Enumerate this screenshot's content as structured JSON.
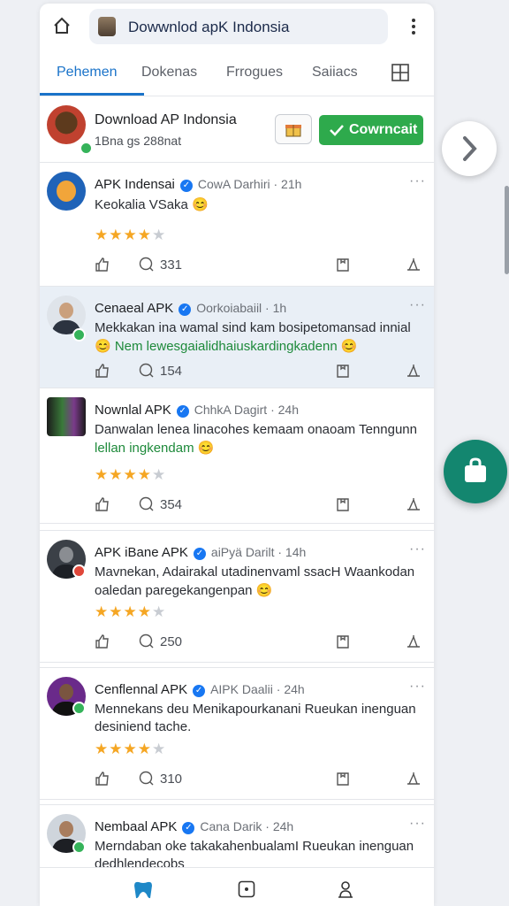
{
  "urlbar": {
    "text": "Dowwnlod apK Indonsia"
  },
  "tabs": [
    {
      "label": "Pehemen"
    },
    {
      "label": "Dokenas"
    },
    {
      "label": "Frrogues"
    },
    {
      "label": "Saiiacs"
    }
  ],
  "header": {
    "title": "Download AP Indonsia",
    "subtitle": "1Bna gs 288nat",
    "download_label": "Cowrncait"
  },
  "posts": [
    {
      "name": "APK Indensai",
      "meta": "CowA Darhiri · 21h",
      "line1": "Keokalia VSaka 😊",
      "line2": "",
      "stars": 4,
      "count": "331",
      "highlight": false
    },
    {
      "name": "Cenaeal APK",
      "meta": "Oorkoiabaiil · 1h",
      "line1": "Mekkakan ina wamal sind kam bosipetomansad innial",
      "line2": "😊 Nem lewesgaialidhaiuskardingkadenn 😊",
      "stars": 0,
      "count": "154",
      "highlight": true
    },
    {
      "name": "Nownlal APK",
      "meta": "ChhkA Dagirt · 24h",
      "line1": "Danwalan lenea linacohes kemaam onaoam Tenngunn",
      "line2": "lellan ingkendam 😊",
      "stars": 4,
      "count": "354",
      "highlight": false
    },
    {
      "name": "APK iBane APK",
      "meta": "aiPyä Darilt · 14h",
      "line1": "Mavnekan, Adairakal utadinenvaml ssacH Waankodan",
      "line2": "oaledan paregekangenpan 😊",
      "stars": 4,
      "count": "250",
      "highlight": false
    },
    {
      "name": "Cenflennal APK",
      "meta": "AIPK Daalii · 24h",
      "line1": "Mennekans deu Menikapourkanani Rueukan inenguan",
      "line2": "desiniend tache.",
      "stars": 4,
      "count": "310",
      "highlight": false
    },
    {
      "name": "Nembaal APK",
      "meta": "Cana Darik · 24h",
      "line1": "Merndaban oke takakahenbualamI Rueukan inenguan",
      "line2": "dedhlendecobs",
      "stars": 0,
      "count": "",
      "highlight": false
    }
  ],
  "colors": {
    "accent": "#1a73c9",
    "download": "#2eaa4c",
    "fab": "#13866f",
    "star": "#f5a623"
  }
}
